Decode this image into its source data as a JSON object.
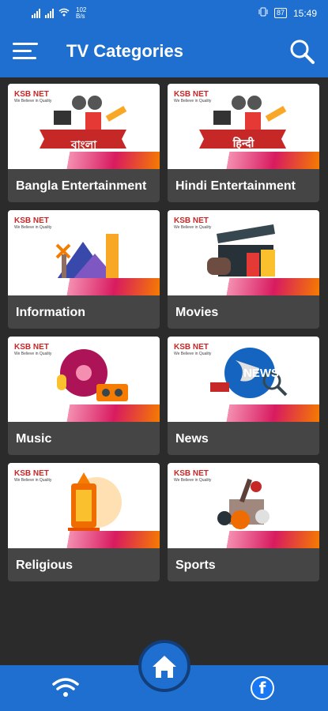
{
  "status_bar": {
    "net_speed_value": "102",
    "net_speed_unit": "B/s",
    "battery": "87",
    "time": "15:49"
  },
  "header": {
    "title": "TV Categories"
  },
  "categories": [
    {
      "label": "Bangla Entertainment",
      "thumb_text": "বাংলা",
      "accent": "#d81b60"
    },
    {
      "label": "Hindi Entertainment",
      "thumb_text": "हिन्दी",
      "accent": "#d81b60"
    },
    {
      "label": "Information",
      "thumb_text": "",
      "accent": "#d81b60"
    },
    {
      "label": "Movies",
      "thumb_text": "",
      "accent": "#d81b60"
    },
    {
      "label": "Music",
      "thumb_text": "",
      "accent": "#d81b60"
    },
    {
      "label": "News",
      "thumb_text": "NEWS",
      "accent": "#d81b60"
    },
    {
      "label": "Religious",
      "thumb_text": "",
      "accent": "#d81b60"
    },
    {
      "label": "Sports",
      "thumb_text": "",
      "accent": "#d81b60"
    }
  ],
  "thumbnail_logo": {
    "brand": "KSB NET",
    "tagline": "We Believe in Quality"
  },
  "bottom_nav": {
    "left_icon": "wifi-icon",
    "center_icon": "home-icon",
    "right_icon": "facebook-icon",
    "facebook_glyph": "f"
  },
  "colors": {
    "primary": "#1e6fcf",
    "background": "#2b2b2b",
    "card": "#454545",
    "stripe_pink": "#d81b60",
    "stripe_orange": "#f57c00"
  }
}
